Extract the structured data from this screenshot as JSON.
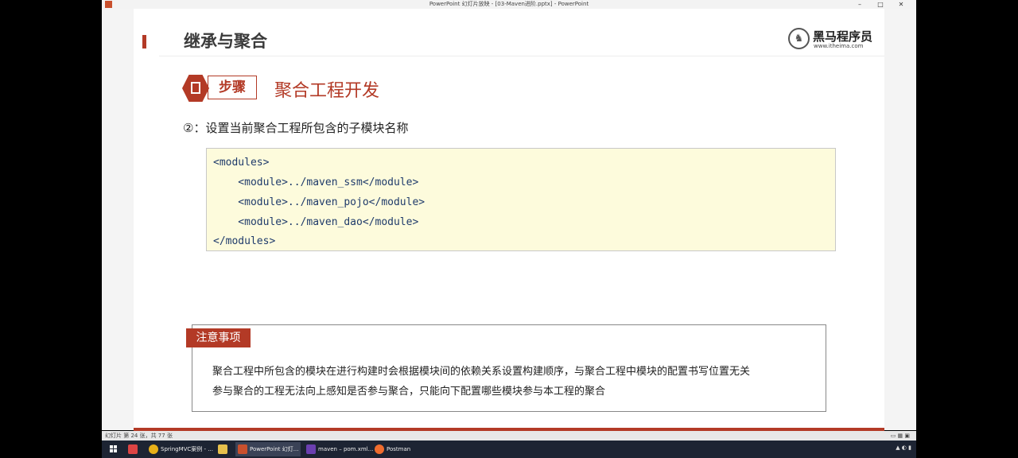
{
  "window": {
    "title": "PowerPoint 幻灯片放映 - [03-Maven进阶.pptx] - PowerPoint",
    "controls": [
      "–",
      "□",
      "✕"
    ]
  },
  "slide": {
    "header_title": "继承与聚合",
    "logo": {
      "name": "黑马程序员",
      "url": "www.itheima.com"
    },
    "step_label": "步骤",
    "step_title": "聚合工程开发",
    "subtitle": "②：设置当前聚合工程所包含的子模块名称",
    "code_lines": [
      "<modules>",
      "    <module>../maven_ssm</module>",
      "    <module>../maven_pojo</module>",
      "    <module>../maven_dao</module>",
      "</modules>"
    ],
    "notice": {
      "label": "注意事项",
      "lines": [
        "聚合工程中所包含的模块在进行构建时会根据模块间的依赖关系设置构建顺序，与聚合工程中模块的配置书写位置无关",
        "参与聚合的工程无法向上感知是否参与聚合，只能向下配置哪些模块参与本工程的聚合"
      ]
    },
    "accent_color": "#b33a26"
  },
  "status_bar": {
    "left": "幻灯片 第 24 张，共 77 张"
  },
  "taskbar": {
    "items": [
      {
        "label": "SpringMVC案例 - ...",
        "icon": "chrome-icon"
      },
      {
        "label": "",
        "icon": "folder-icon"
      },
      {
        "label": "PowerPoint 幻灯...",
        "icon": "powerpoint-icon"
      },
      {
        "label": "maven – pom.xml...",
        "icon": "intellij-icon"
      },
      {
        "label": "Postman",
        "icon": "postman-icon"
      }
    ]
  }
}
